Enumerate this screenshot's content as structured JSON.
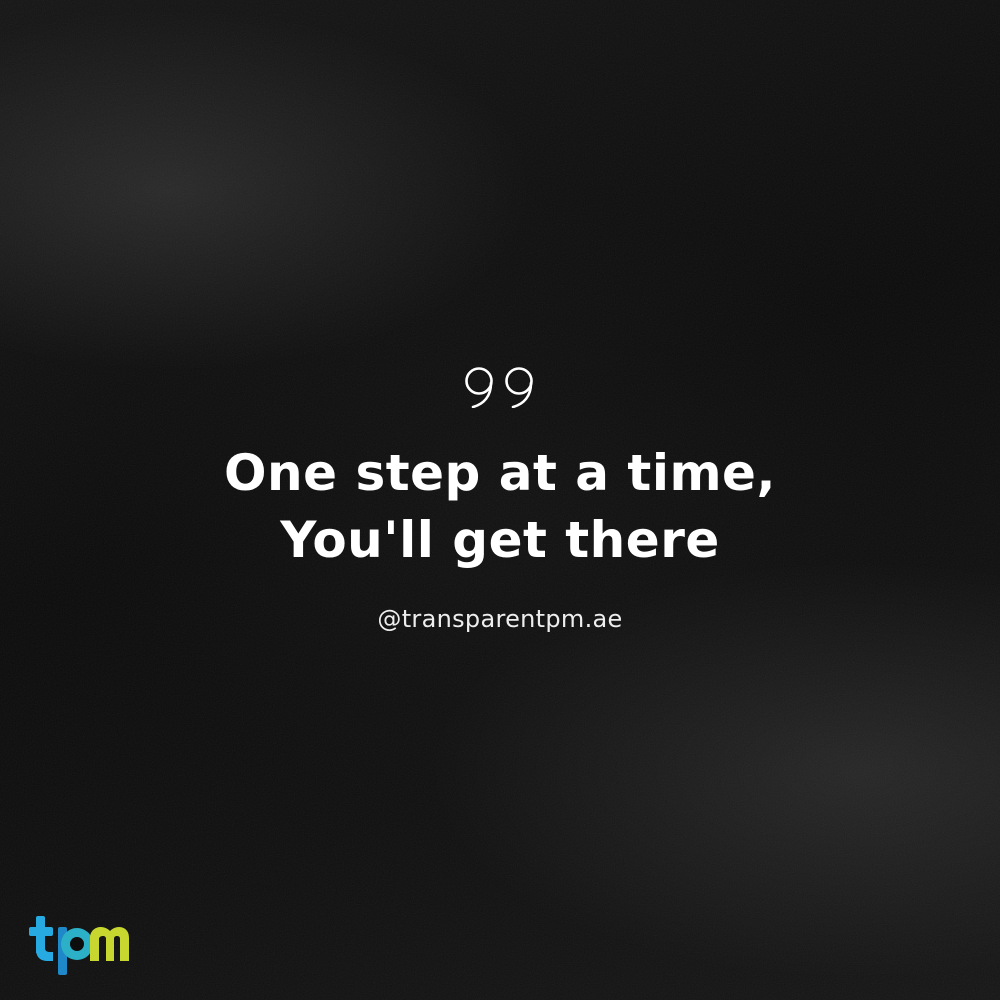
{
  "quote": {
    "line1": "One step at a time,",
    "line2": "You'll get there",
    "icon": "quote-marks-icon"
  },
  "handle": "@transparentpm.ae",
  "logo": {
    "text": "tpm",
    "colors": {
      "t": "#27a9e1",
      "p": "#1e9bd7",
      "m": "#c8d630"
    }
  },
  "colors": {
    "background": "#0b0b0b",
    "text": "#ffffff"
  }
}
